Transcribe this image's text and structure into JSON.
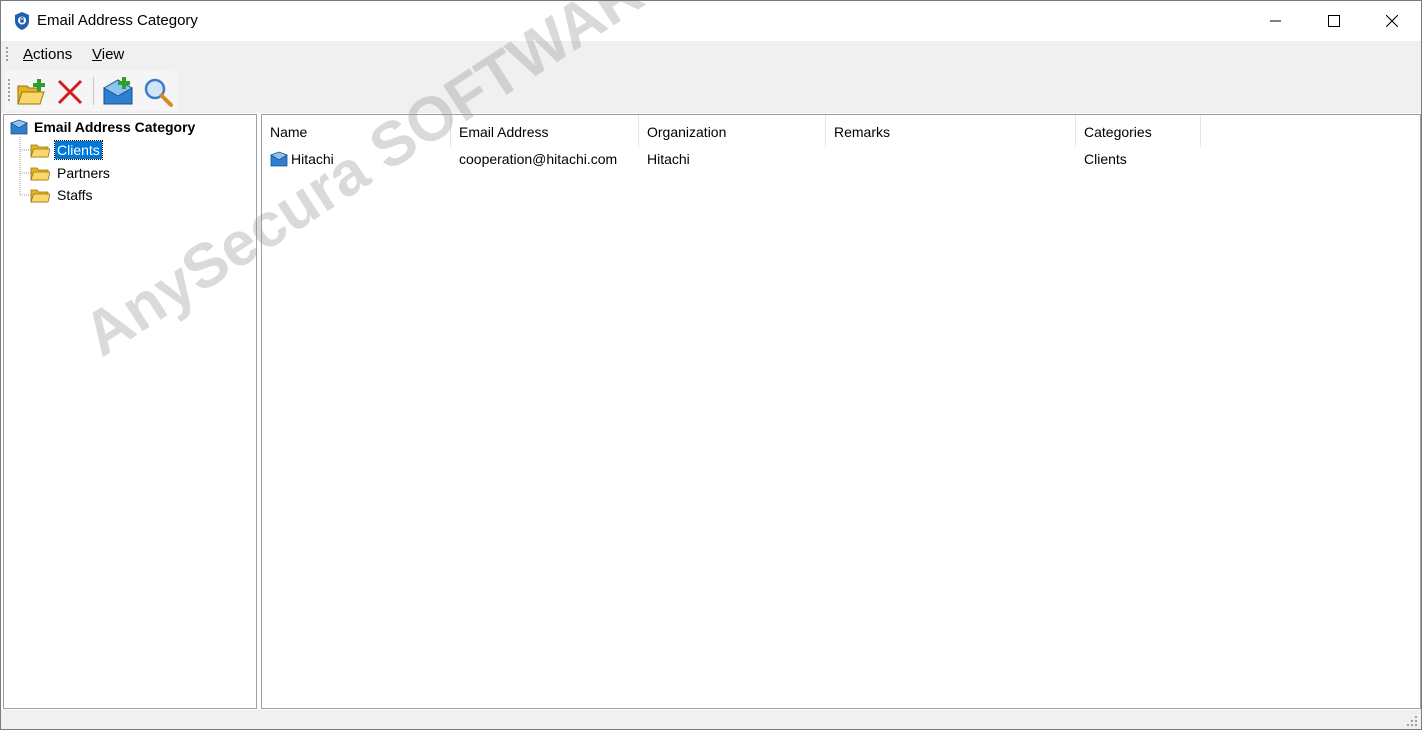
{
  "window": {
    "title": "Email Address Category"
  },
  "menu": {
    "actions_label": "Actions",
    "actions_underline": "A",
    "actions_rest": "ctions",
    "view_label": "View",
    "view_underline": "V",
    "view_rest": "iew"
  },
  "toolbar": {
    "buttons": [
      {
        "name": "add-category",
        "icon": "folder-add-icon"
      },
      {
        "name": "delete",
        "icon": "red-x-icon"
      },
      {
        "name": "add-email",
        "icon": "mail-add-icon"
      },
      {
        "name": "search",
        "icon": "magnifier-icon"
      }
    ]
  },
  "tree": {
    "root": "Email Address Category",
    "nodes": [
      {
        "label": "Clients",
        "selected": true
      },
      {
        "label": "Partners",
        "selected": false
      },
      {
        "label": "Staffs",
        "selected": false
      }
    ]
  },
  "list": {
    "columns": [
      "Name",
      "Email Address",
      "Organization",
      "Remarks",
      "Categories"
    ],
    "rows": [
      {
        "name": "Hitachi",
        "email": "cooperation@hitachi.com",
        "organization": "Hitachi",
        "remarks": "",
        "categories": "Clients"
      }
    ]
  },
  "watermark": {
    "line1": "AnySecura SOFTWARE PTE. LTD"
  },
  "colors": {
    "selection": "#0078d7",
    "chrome": "#f0f0f0",
    "app_icon": "#1e5fb4"
  }
}
